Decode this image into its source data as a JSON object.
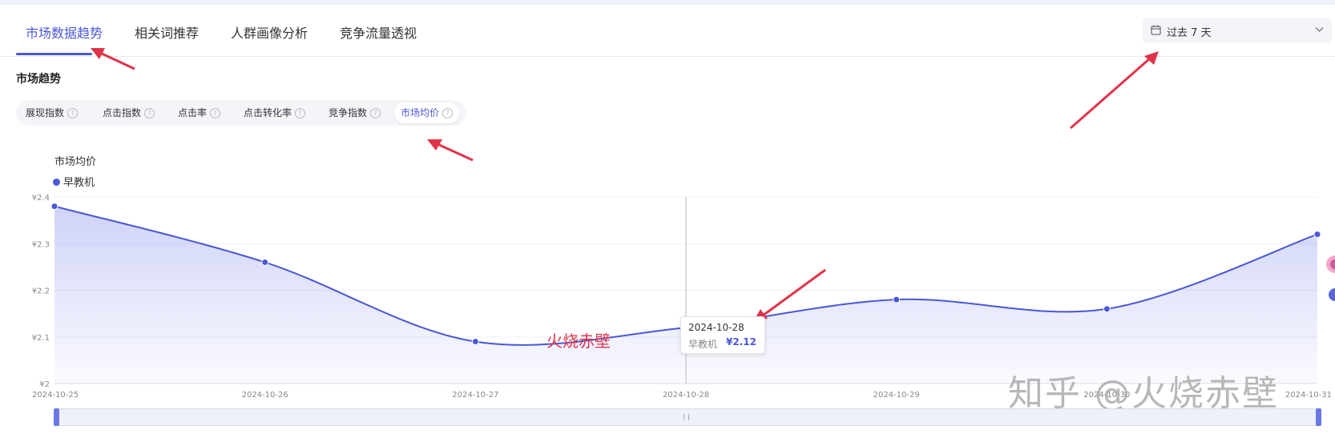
{
  "tabs": [
    {
      "label": "市场数据趋势",
      "active": true
    },
    {
      "label": "相关词推荐",
      "active": false
    },
    {
      "label": "人群画像分析",
      "active": false
    },
    {
      "label": "竞争流量透视",
      "active": false
    }
  ],
  "date_range": {
    "label": "过去 7 天",
    "icon": "calendar-icon"
  },
  "section_title": "市场趋势",
  "metric_tabs": [
    {
      "label": "展现指数",
      "active": false
    },
    {
      "label": "点击指数",
      "active": false
    },
    {
      "label": "点击率",
      "active": false
    },
    {
      "label": "点击转化率",
      "active": false
    },
    {
      "label": "竞争指数",
      "active": false
    },
    {
      "label": "市场均价",
      "active": true
    }
  ],
  "help_icon_glyph": "?",
  "tooltip": {
    "date": "2024-10-28",
    "series": "早教机",
    "value": "¥2.12"
  },
  "overlay_text": "火烧赤壁",
  "watermark": "知乎 @火烧赤壁",
  "colors": {
    "accent": "#4a57d6",
    "arrow": "#e0344a"
  },
  "chart_data": {
    "type": "area",
    "title": "市场均价",
    "x": [
      "2024-10-25",
      "2024-10-26",
      "2024-10-27",
      "2024-10-28",
      "2024-10-29",
      "2024-10-30",
      "2024-10-31"
    ],
    "series": [
      {
        "name": "早教机",
        "values": [
          2.38,
          2.26,
          2.09,
          2.12,
          2.18,
          2.16,
          2.32
        ]
      }
    ],
    "ylim": [
      2.0,
      2.4
    ],
    "yticks": [
      {
        "value": 2.4,
        "label": "¥2.4"
      },
      {
        "value": 2.3,
        "label": "¥2.3"
      },
      {
        "value": 2.2,
        "label": "¥2.2"
      },
      {
        "value": 2.1,
        "label": "¥2.1"
      },
      {
        "value": 2.0,
        "label": "¥2"
      }
    ],
    "xticks": [
      "2024-10-25",
      "2024-10-26",
      "2024-10-27",
      "2024-10-28",
      "2024-10-29",
      "2024-10-30",
      "2024-10-31"
    ],
    "highlight_index": 3,
    "grid": true,
    "legend": "top-left",
    "currency": "¥"
  }
}
